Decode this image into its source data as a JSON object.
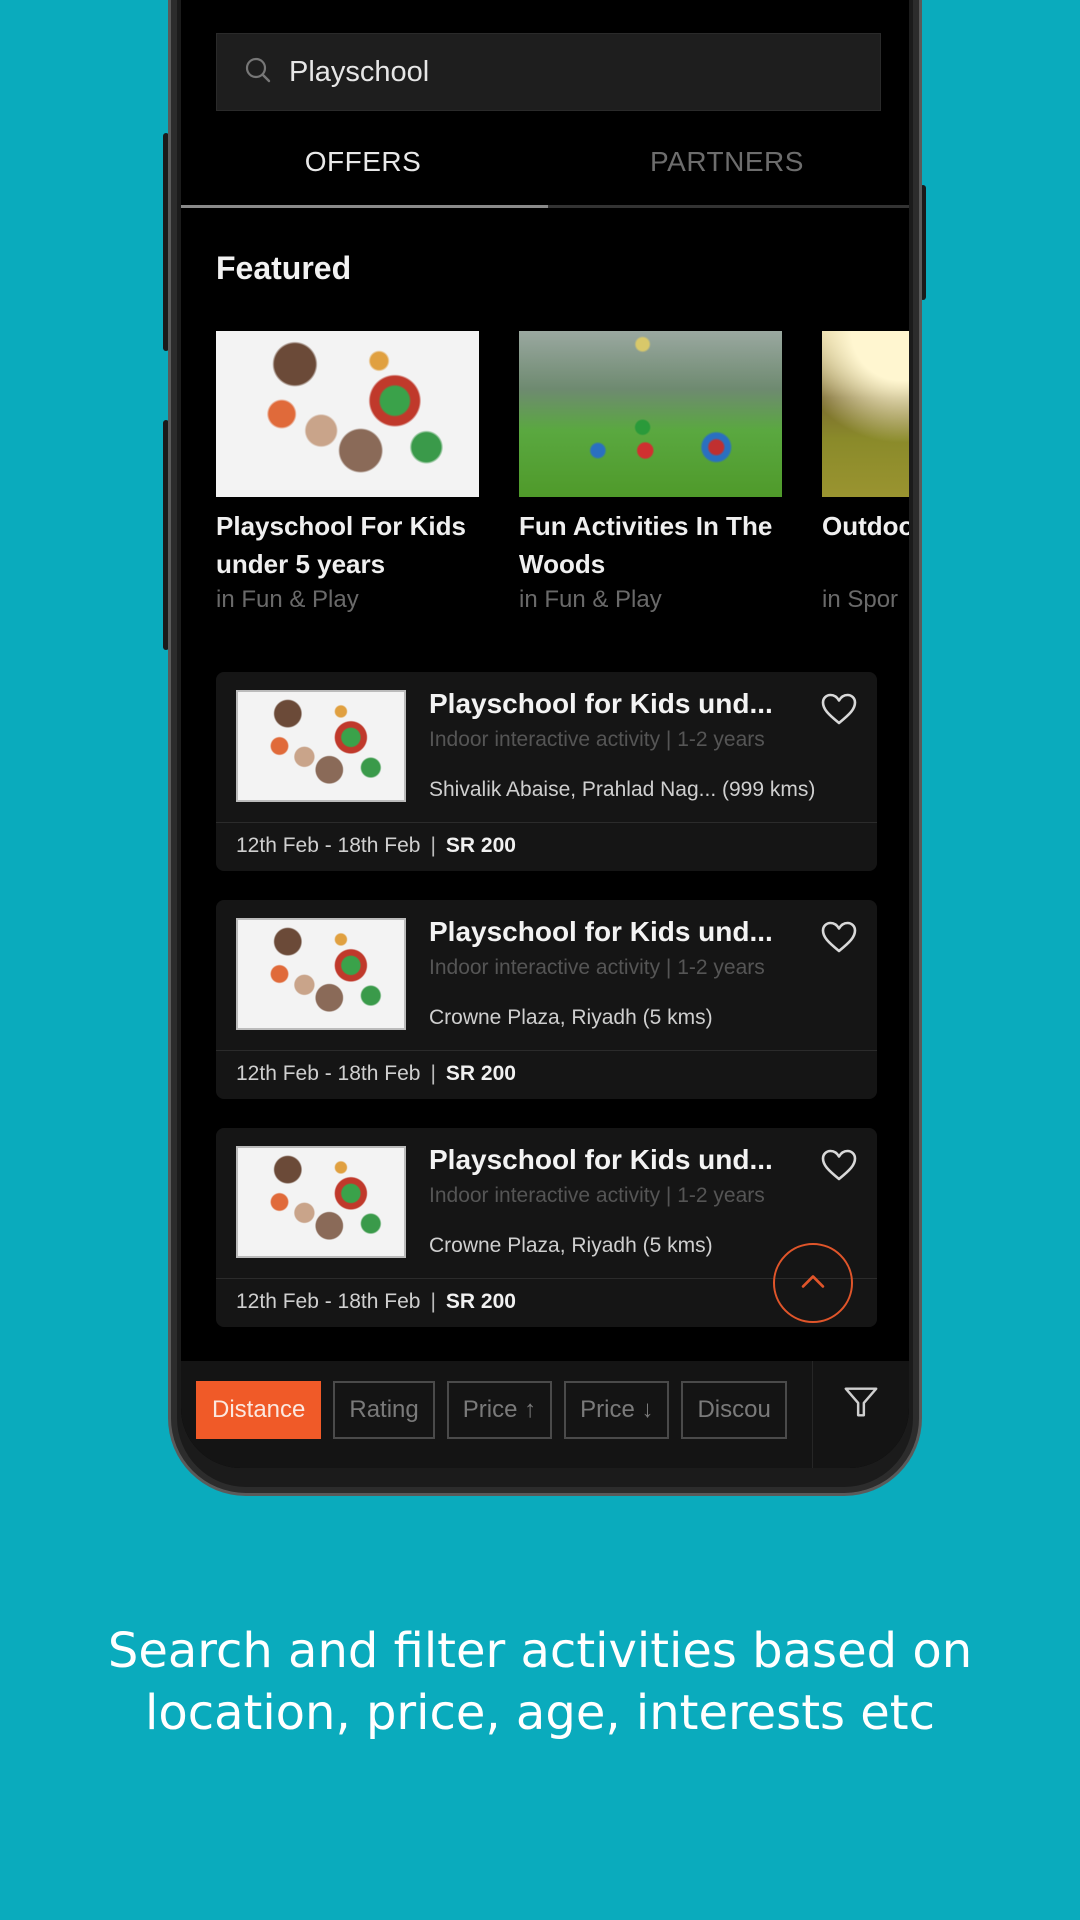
{
  "search": {
    "value": "Playschool",
    "icon": "search-icon"
  },
  "tabs": [
    {
      "label": "OFFERS",
      "active": true
    },
    {
      "label": "PARTNERS",
      "active": false
    }
  ],
  "featured": {
    "heading": "Featured",
    "items": [
      {
        "title_line1": "Playschool For Kids",
        "title_line2": "under 5 years",
        "category": "in Fun & Play"
      },
      {
        "title_line1": "Fun Activities In The",
        "title_line2": "Woods",
        "category": "in Fun & Play"
      },
      {
        "title_line1": "Outdoo",
        "title_line2": "",
        "category": "in Spor"
      }
    ]
  },
  "offers": [
    {
      "title": "Playschool for Kids und...",
      "subtitle": "Indoor interactive activity | 1-2 years",
      "location": "Shivalik Abaise, Prahlad Nag... (999 kms)",
      "dates": "12th Feb - 18th Feb",
      "separator": "|",
      "price": "SR 200",
      "favorite_icon": "heart-outline-icon"
    },
    {
      "title": "Playschool for Kids und...",
      "subtitle": "Indoor interactive activity | 1-2 years",
      "location": "Crowne Plaza, Riyadh (5 kms)",
      "dates": "12th Feb - 18th Feb",
      "separator": "|",
      "price": "SR 200",
      "favorite_icon": "heart-outline-icon"
    },
    {
      "title": "Playschool for Kids und...",
      "subtitle": "Indoor interactive activity | 1-2 years",
      "location": "Crowne Plaza, Riyadh (5 kms)",
      "dates": "12th Feb - 18th Feb",
      "separator": "|",
      "price": "SR 200",
      "favorite_icon": "heart-outline-icon"
    }
  ],
  "sort_chips": [
    {
      "label": "Distance",
      "active": true
    },
    {
      "label": "Rating",
      "active": false
    },
    {
      "label": "Price ↑",
      "active": false
    },
    {
      "label": "Price ↓",
      "active": false
    },
    {
      "label": "Discou",
      "active": false
    }
  ],
  "filter_icon": "funnel-icon",
  "scroll_top_icon": "chevron-up-icon",
  "caption": {
    "line1": "Search and filter activities based on",
    "line2": "location, price, age, interests etc"
  },
  "colors": {
    "background": "#0AABBD",
    "accent": "#F05A28",
    "screen": "#000000",
    "card": "#151515"
  }
}
